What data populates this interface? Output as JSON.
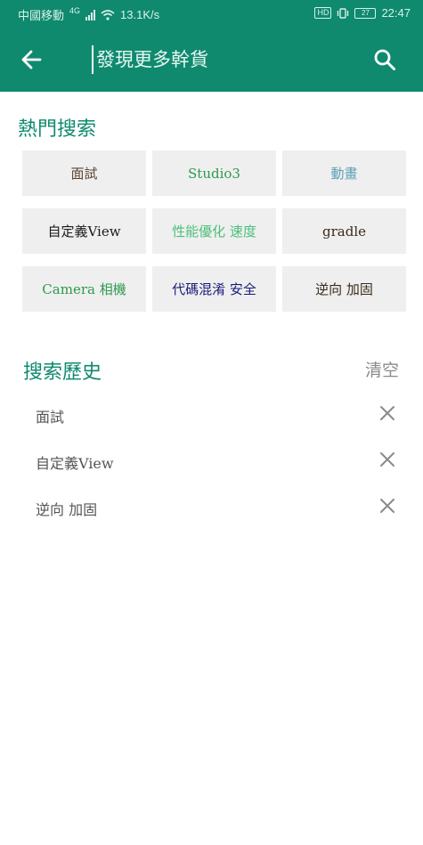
{
  "status_bar": {
    "carrier": "中國移動",
    "network": "4G",
    "speed": "13.1K/s",
    "hd": "HD",
    "battery": "27",
    "time": "22:47"
  },
  "toolbar": {
    "search_placeholder": "發現更多幹貨",
    "back_icon": "arrow-left-icon",
    "search_icon": "search-icon"
  },
  "hot_search": {
    "title": "熱門搜索",
    "tags": [
      {
        "label": "面試",
        "color": "#5a4636"
      },
      {
        "label": "Studio3",
        "color": "#2e9a4e"
      },
      {
        "label": "動畫",
        "color": "#5aa0b8"
      },
      {
        "label": "自定義View",
        "color": "#1a1a1a"
      },
      {
        "label": "性能優化 速度",
        "color": "#4cc07a"
      },
      {
        "label": "gradle",
        "color": "#3a2a1a"
      },
      {
        "label": "Camera 相機",
        "color": "#2e9a4e"
      },
      {
        "label": "代碼混淆 安全",
        "color": "#1a1a7a"
      },
      {
        "label": "逆向 加固",
        "color": "#3a2a1a"
      }
    ]
  },
  "history": {
    "title": "搜索歷史",
    "clear_label": "清空",
    "items": [
      {
        "label": "面試"
      },
      {
        "label": "自定義View"
      },
      {
        "label": "逆向 加固"
      }
    ]
  },
  "colors": {
    "primary": "#0f8a6f",
    "chip_bg": "#efefef"
  }
}
